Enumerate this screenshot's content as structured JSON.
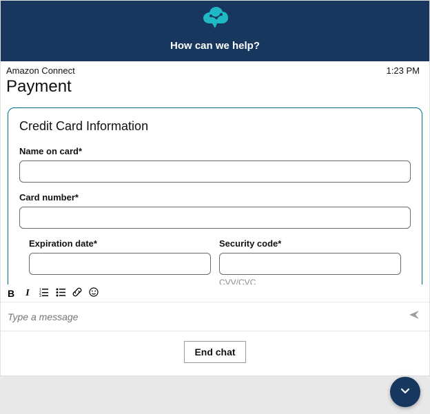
{
  "header": {
    "title": "How can we help?"
  },
  "meta": {
    "sender": "Amazon Connect",
    "time": "1:23 PM"
  },
  "page": {
    "title": "Payment"
  },
  "card": {
    "title": "Credit Card Information",
    "name_label": "Name on card*",
    "name_value": "",
    "number_label": "Card number*",
    "number_value": "",
    "exp_label": "Expiration date*",
    "exp_value": "",
    "cvv_label": "Security code*",
    "cvv_value": "",
    "cvv_hint": "CVV/CVC"
  },
  "composer": {
    "placeholder": "Type a message"
  },
  "footer": {
    "end_label": "End chat"
  }
}
